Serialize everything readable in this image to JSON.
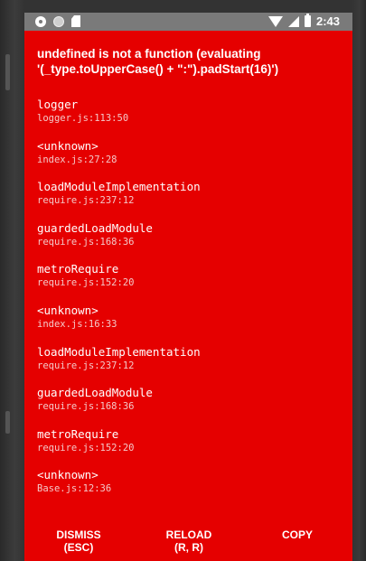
{
  "status_bar": {
    "time": "2:43",
    "left_icons": [
      "gear-icon",
      "circle-icon",
      "sdcard-icon"
    ],
    "right_icons": [
      "wifi-icon",
      "signal-icon",
      "battery-icon"
    ]
  },
  "error": {
    "title": "undefined is not a function (evaluating '(_type.toUpperCase() + \":\").padStart(16)')"
  },
  "stack": [
    {
      "name": "logger",
      "location": "logger.js:113:50"
    },
    {
      "name": "<unknown>",
      "location": "index.js:27:28"
    },
    {
      "name": "loadModuleImplementation",
      "location": "require.js:237:12"
    },
    {
      "name": "guardedLoadModule",
      "location": "require.js:168:36"
    },
    {
      "name": "metroRequire",
      "location": "require.js:152:20"
    },
    {
      "name": "<unknown>",
      "location": "index.js:16:33"
    },
    {
      "name": "loadModuleImplementation",
      "location": "require.js:237:12"
    },
    {
      "name": "guardedLoadModule",
      "location": "require.js:168:36"
    },
    {
      "name": "metroRequire",
      "location": "require.js:152:20"
    },
    {
      "name": "<unknown>",
      "location": "Base.js:12:36"
    }
  ],
  "buttons": {
    "dismiss": {
      "line1": "DISMISS",
      "line2": "(ESC)"
    },
    "reload": {
      "line1": "RELOAD",
      "line2": "(R, R)"
    },
    "copy": {
      "line1": "COPY"
    }
  },
  "colors": {
    "background": "#e50000",
    "status_bar": "#7a7a7a",
    "text": "#ffffff"
  }
}
